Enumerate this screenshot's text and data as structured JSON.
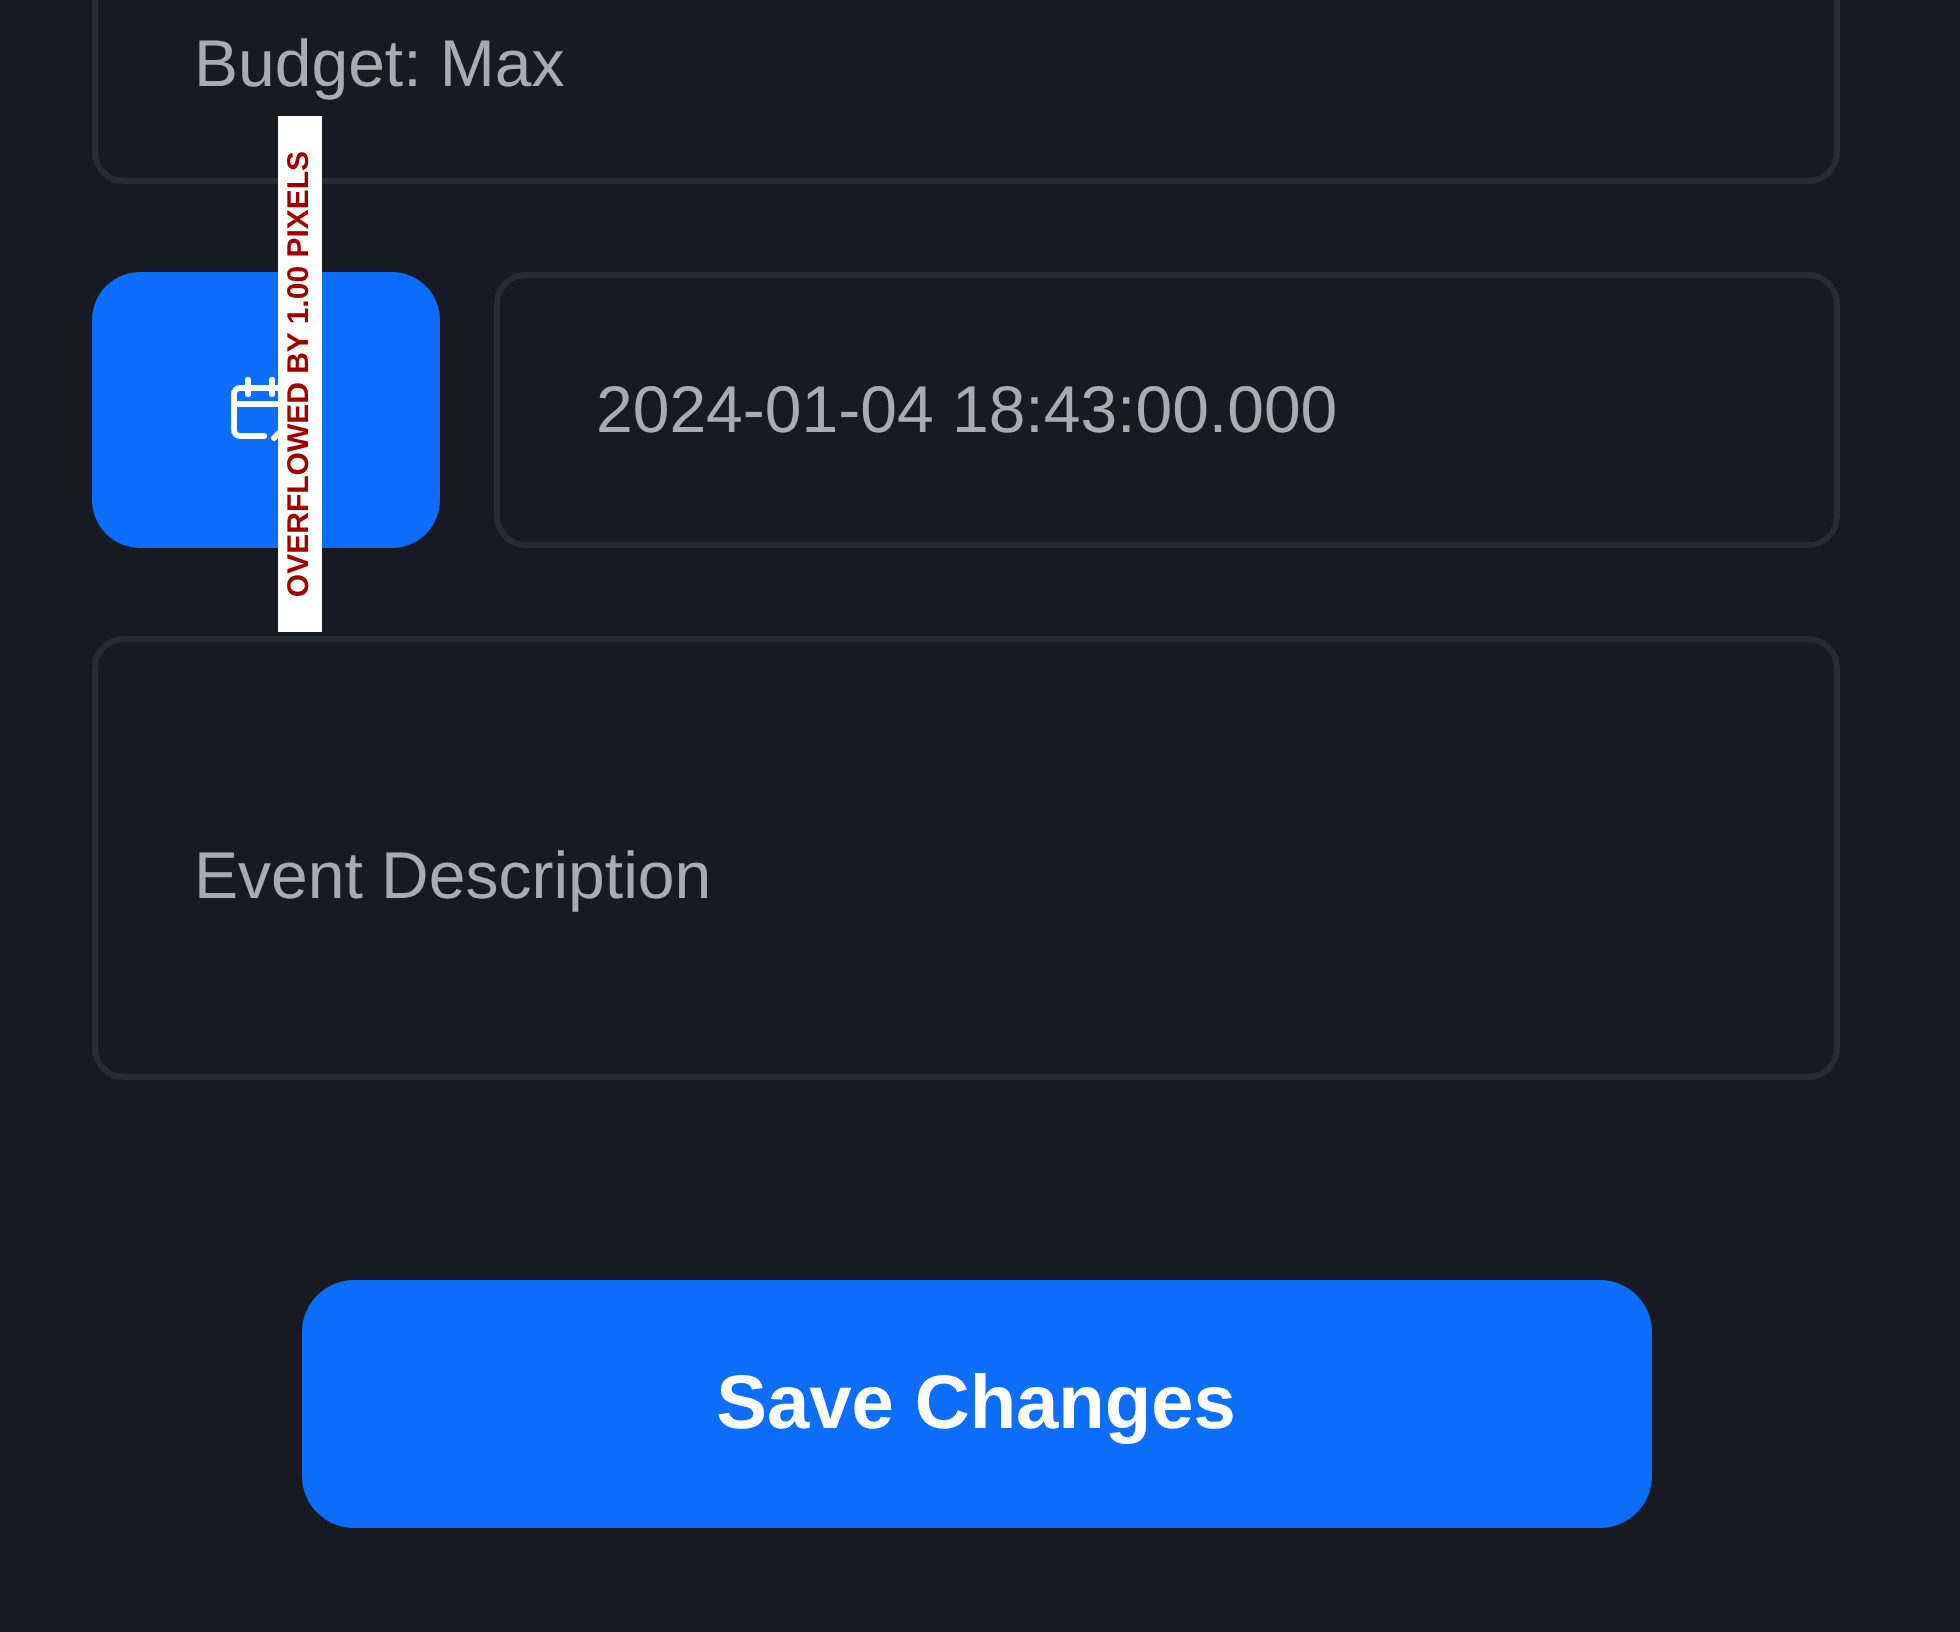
{
  "budget_field": {
    "value": "Budget: Max"
  },
  "date_button": {
    "disabled": false
  },
  "date_field": {
    "value": "2024-01-04 18:43:00.000"
  },
  "description_field": {
    "placeholder": "Event Description"
  },
  "save_button": {
    "label": "Save Changes"
  },
  "overflow_warning": "OVERFLOWED BY 1.00 PIXELS"
}
